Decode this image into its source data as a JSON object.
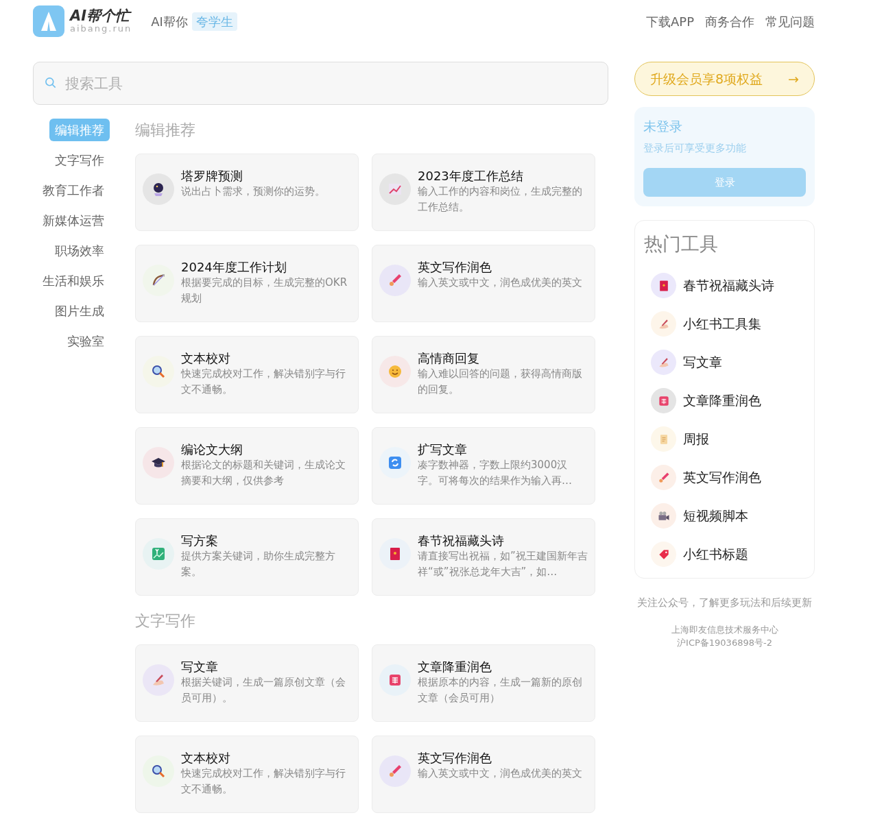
{
  "header": {
    "logo_title": "AI帮个忙",
    "logo_subtitle": "aibang.run",
    "tagline": "AI帮你",
    "tag": "夸学生",
    "links": [
      "下载APP",
      "商务合作",
      "常见问题"
    ]
  },
  "search": {
    "placeholder": "搜索工具"
  },
  "nav": [
    {
      "label": "编辑推荐",
      "selected": true
    },
    {
      "label": "文字写作",
      "selected": false
    },
    {
      "label": "教育工作者",
      "selected": false
    },
    {
      "label": "新媒体运营",
      "selected": false
    },
    {
      "label": "职场效率",
      "selected": false
    },
    {
      "label": "生活和娱乐",
      "selected": false
    },
    {
      "label": "图片生成",
      "selected": false
    },
    {
      "label": "实验室",
      "selected": false
    }
  ],
  "sections": [
    {
      "title": "编辑推荐",
      "tools": [
        {
          "name": "塔罗牌预测",
          "desc": "说出占卜需求，预测你的运势。"
        },
        {
          "name": "2023年度工作总结",
          "desc": "输入工作的内容和岗位，生成完整的工作总结。"
        },
        {
          "name": "2024年度工作计划",
          "desc": "根据要完成的目标，生成完整的OKR规划"
        },
        {
          "name": "英文写作润色",
          "desc": "输入英文或中文，润色成优美的英文"
        },
        {
          "name": "文本校对",
          "desc": "快速完成校对工作，解决错别字与行文不通畅。"
        },
        {
          "name": "高情商回复",
          "desc": "输入难以回答的问题，获得高情商版的回复。"
        },
        {
          "name": "编论文大纲",
          "desc": "根据论文的标题和关键词，生成论文摘要和大纲，仅供参考"
        },
        {
          "name": "扩写文章",
          "desc": "凑字数神器，字数上限约3000汉字。可将每次的结果作为输入再…"
        },
        {
          "name": "写方案",
          "desc": "提供方案关键词，助你生成完整方案。"
        },
        {
          "name": "春节祝福藏头诗",
          "desc": "请直接写出祝福，如”祝王建国新年吉祥“或”祝张总龙年大吉”，如…"
        }
      ]
    },
    {
      "title": "文字写作",
      "tools": [
        {
          "name": "写文章",
          "desc": "根据关键词，生成一篇原创文章（会员可用）。"
        },
        {
          "name": "文章降重润色",
          "desc": "根据原本的内容，生成一篇新的原创文章（会员可用）"
        },
        {
          "name": "文本校对",
          "desc": "快速完成校对工作，解决错别字与行文不通畅。"
        },
        {
          "name": "英文写作润色",
          "desc": "输入英文或中文，润色成优美的英文"
        }
      ]
    }
  ],
  "upgrade": {
    "label": "升级会员享8项权益",
    "arrow": "→"
  },
  "login": {
    "title": "未登录",
    "subtitle": "登录后可享受更多功能",
    "button": "登录"
  },
  "hot": {
    "title": "热门工具",
    "items": [
      "春节祝福藏头诗",
      "小红书工具集",
      "写文章",
      "文章降重润色",
      "周报",
      "英文写作润色",
      "短视频脚本",
      "小红书标题"
    ]
  },
  "footer": {
    "follow": "关注公众号，了解更多玩法和后续更新",
    "company": "上海即友信息技术服务中心",
    "icp": "沪ICP备19036898号-2"
  }
}
